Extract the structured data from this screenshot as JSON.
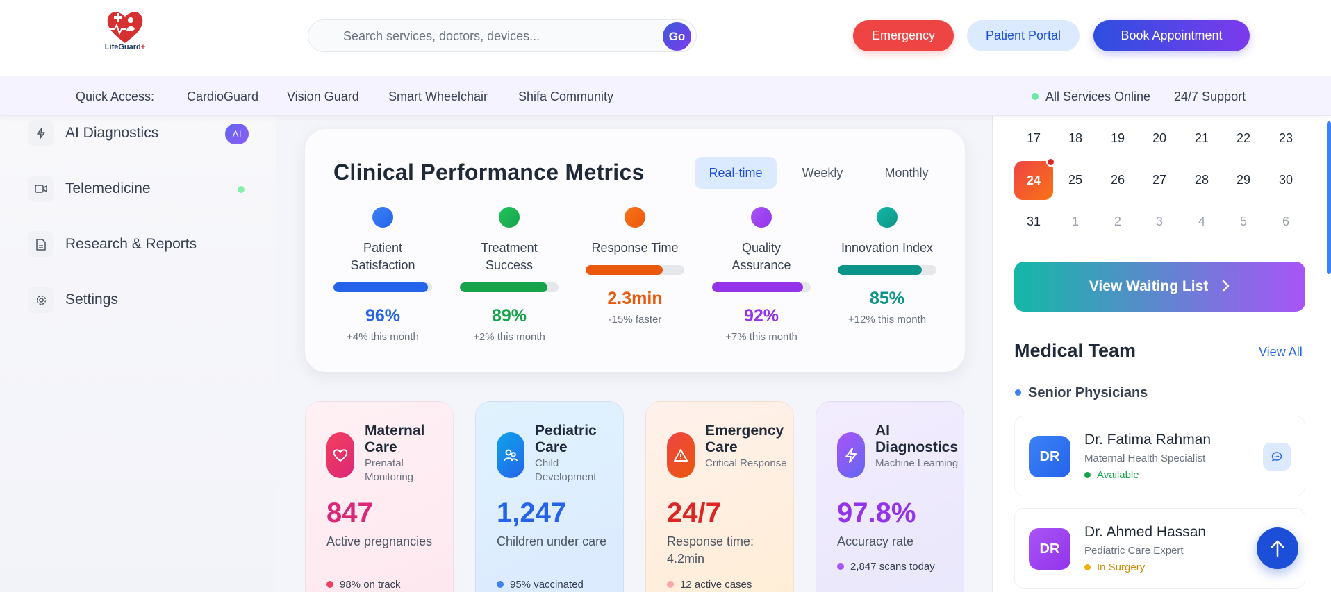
{
  "header": {
    "logo_text": "LifeGuard",
    "logo_plus": "+",
    "search_placeholder": "Search services, doctors, devices...",
    "search_go": "Go",
    "emergency": "Emergency",
    "patient_portal": "Patient Portal",
    "book_appointment": "Book Appointment"
  },
  "quick_access": {
    "label": "Quick Access:",
    "links": [
      "CardioGuard",
      "Vision Guard",
      "Smart Wheelchair",
      "Shifa Community"
    ],
    "status": "All Services Online",
    "support": "24/7 Support"
  },
  "sidebar": {
    "items": [
      {
        "label": "AI Diagnostics",
        "badge": "AI",
        "icon": "bolt-icon"
      },
      {
        "label": "Telemedicine",
        "icon": "video-icon"
      },
      {
        "label": "Research & Reports",
        "icon": "document-icon"
      },
      {
        "label": "Settings",
        "icon": "gear-icon"
      }
    ]
  },
  "metrics": {
    "title": "Clinical Performance Metrics",
    "tabs": [
      "Real-time",
      "Weekly",
      "Monthly"
    ],
    "active_tab": "Real-time",
    "items": [
      {
        "label": "Patient Satisfaction",
        "value": "96%",
        "change": "+4% this month",
        "fill": 0.96,
        "color": "#2563eb"
      },
      {
        "label": "Treatment Success",
        "value": "89%",
        "change": "+2% this month",
        "fill": 0.89,
        "color": "#16a34a"
      },
      {
        "label": "Response Time",
        "value": "2.3min",
        "change": "-15% faster",
        "fill": 0.78,
        "color": "#ea580c"
      },
      {
        "label": "Quality Assurance",
        "value": "92%",
        "change": "+7% this month",
        "fill": 0.92,
        "color": "#9333ea"
      },
      {
        "label": "Innovation Index",
        "value": "85%",
        "change": "+12% this month",
        "fill": 0.85,
        "color": "#0d9488"
      }
    ]
  },
  "services": [
    {
      "title": "Maternal Care",
      "subtitle": "Prenatal Monitoring",
      "value": "847",
      "desc": "Active pregnancies",
      "note": "98% on track",
      "icon": "heart-icon",
      "color": "#db2777"
    },
    {
      "title": "Pediatric Care",
      "subtitle": "Child Development",
      "value": "1,247",
      "desc": "Children under care",
      "note": "95% vaccinated",
      "icon": "users-icon",
      "color": "#2563eb"
    },
    {
      "title": "Emergency Care",
      "subtitle": "Critical Response",
      "value": "24/7",
      "desc": "Response time: 4.2min",
      "note": "12 active cases",
      "icon": "alert-icon",
      "color": "#dc2626"
    },
    {
      "title": "AI Diagnostics",
      "subtitle": "Machine Learning",
      "value": "97.8%",
      "desc": "Accuracy rate",
      "note": "2,847 scans today",
      "icon": "bolt-icon",
      "color": "#9333ea"
    }
  ],
  "calendar": {
    "rows": [
      [
        "17",
        "18",
        "19",
        "20",
        "21",
        "22",
        "23"
      ],
      [
        "24",
        "25",
        "26",
        "27",
        "28",
        "29",
        "30"
      ],
      [
        "31",
        "1",
        "2",
        "3",
        "4",
        "5",
        "6"
      ]
    ],
    "today": "24"
  },
  "waiting_list": "View Waiting List",
  "team": {
    "title": "Medical Team",
    "view_all": "View All",
    "group": "Senior Physicians",
    "doctors": [
      {
        "initials": "DR",
        "name": "Dr. Fatima Rahman",
        "specialty": "Maternal Health Specialist",
        "status": "Available",
        "status_color": "#16a34a"
      },
      {
        "initials": "DR",
        "name": "Dr. Ahmed Hassan",
        "specialty": "Pediatric Care Expert",
        "status": "In Surgery",
        "status_color": "#ca8a04"
      }
    ]
  }
}
